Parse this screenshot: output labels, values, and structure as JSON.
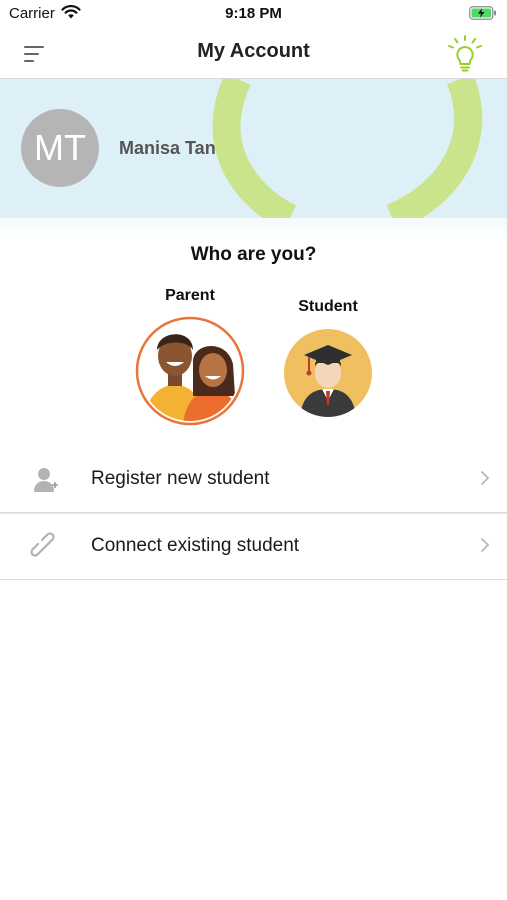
{
  "status_bar": {
    "carrier": "Carrier",
    "time": "9:18 PM"
  },
  "header": {
    "title": "My Account",
    "menu_icon": "menu-lines-icon",
    "tip_icon": "lightbulb-icon",
    "tip_color": "#9ccc2e"
  },
  "profile": {
    "initials": "MT",
    "name": "Manisa Tan",
    "banner_color": "#def0f7",
    "ring_color": "#c9e48a"
  },
  "role_selector": {
    "question": "Who are you?",
    "roles": [
      {
        "label": "Parent",
        "selected": true,
        "ring_color": "#e8753a"
      },
      {
        "label": "Student",
        "selected": false,
        "bg_color": "#f0c060"
      }
    ]
  },
  "actions": [
    {
      "label": "Register new student",
      "icon": "add-person-icon"
    },
    {
      "label": "Connect existing student",
      "icon": "link-icon"
    }
  ]
}
